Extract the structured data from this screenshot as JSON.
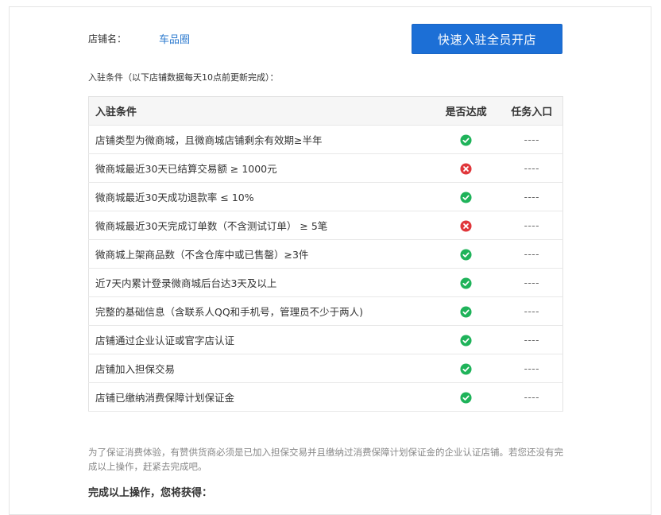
{
  "shop": {
    "label": "店铺名：",
    "name": "车品圈"
  },
  "primary_button": {
    "label": "快速入驻全员开店"
  },
  "section_note": "入驻条件（以下店铺数据每天10点前更新完成）：",
  "table": {
    "headers": {
      "condition": "入驻条件",
      "met": "是否达成",
      "task": "任务入口"
    },
    "rows": [
      {
        "condition": "店铺类型为微商城，且微商城店铺剩余有效期≥半年",
        "met": true,
        "task": "----"
      },
      {
        "condition": "微商城最近30天已结算交易额 ≥ 1000元",
        "met": false,
        "task": "----"
      },
      {
        "condition": "微商城最近30天成功退款率 ≤ 10%",
        "met": true,
        "task": "----"
      },
      {
        "condition": "微商城最近30天完成订单数（不含测试订单） ≥ 5笔",
        "met": false,
        "task": "----"
      },
      {
        "condition": "微商城上架商品数（不含仓库中或已售罄）≥3件",
        "met": true,
        "task": "----"
      },
      {
        "condition": "近7天内累计登录微商城后台达3天及以上",
        "met": true,
        "task": "----"
      },
      {
        "condition": "完整的基础信息（含联系人QQ和手机号，管理员不少于两人)",
        "met": true,
        "task": "----"
      },
      {
        "condition": "店铺通过企业认证或官字店认证",
        "met": true,
        "task": "----"
      },
      {
        "condition": "店铺加入担保交易",
        "met": true,
        "task": "----"
      },
      {
        "condition": "店铺已缴纳消费保障计划保证金",
        "met": true,
        "task": "----"
      }
    ]
  },
  "footer": {
    "note": "为了保证消费体验，有赞供货商必须是已加入担保交易并且缴纳过消费保障计划保证金的企业认证店铺。若您还没有完成以上操作，赶紧去完成吧。",
    "heading": "完成以上操作，您将获得："
  },
  "colors": {
    "accent": "#1c6fd6",
    "link": "#2e7bcf",
    "success": "#1fb35a",
    "fail": "#e0373b"
  }
}
